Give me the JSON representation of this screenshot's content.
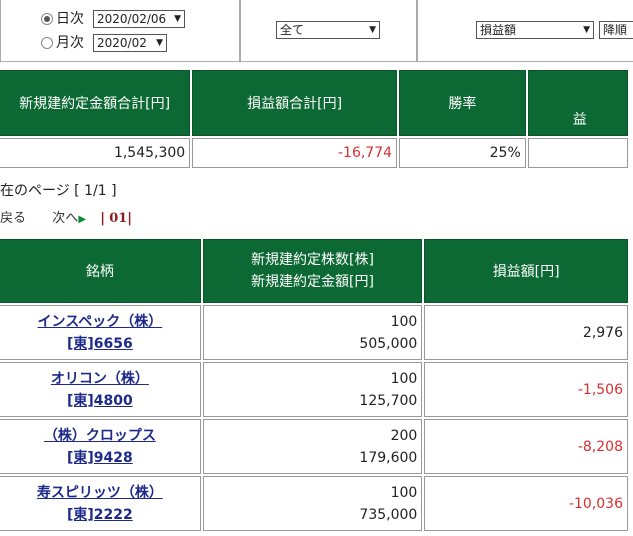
{
  "filter": {
    "daily_label": "日次",
    "daily_date": "2020/02/06",
    "monthly_label": "月次",
    "monthly_date": "2020/02",
    "category": "全て",
    "metric": "損益額",
    "order": "降順"
  },
  "summary": {
    "headers": [
      "新規建約定金額合計[円]",
      "損益額合計[円]",
      "勝率",
      "益"
    ],
    "values": {
      "total_amount": "1,545,300",
      "total_pl": "-16,774",
      "win_rate": "25%"
    }
  },
  "pager": {
    "current_page": "在のページ [ 1/1 ]",
    "back": "戻る",
    "next": "次へ",
    "page_link": "01"
  },
  "table": {
    "headers": {
      "name": "銘柄",
      "qty_line1": "新規建約定株数[株]",
      "qty_line2": "新規建約定金額[円]",
      "pl": "損益額[円]"
    },
    "rows": [
      {
        "name": "インスペック（株）",
        "code": "[東]6656",
        "shares": "100",
        "amount": "505,000",
        "pl": "2,976"
      },
      {
        "name": "オリコン（株）",
        "code": "[東]4800",
        "shares": "100",
        "amount": "125,700",
        "pl": "-1,506"
      },
      {
        "name": "（株）クロップス",
        "code": "[東]9428",
        "shares": "200",
        "amount": "179,600",
        "pl": "-8,208"
      },
      {
        "name": "寿スピリッツ（株）",
        "code": "[東]2222",
        "shares": "100",
        "amount": "735,000",
        "pl": "-10,036"
      }
    ]
  },
  "colors": {
    "header_green": "#0d6934",
    "negative_red": "#d62f2f",
    "link_blue": "#1d2a8a"
  }
}
